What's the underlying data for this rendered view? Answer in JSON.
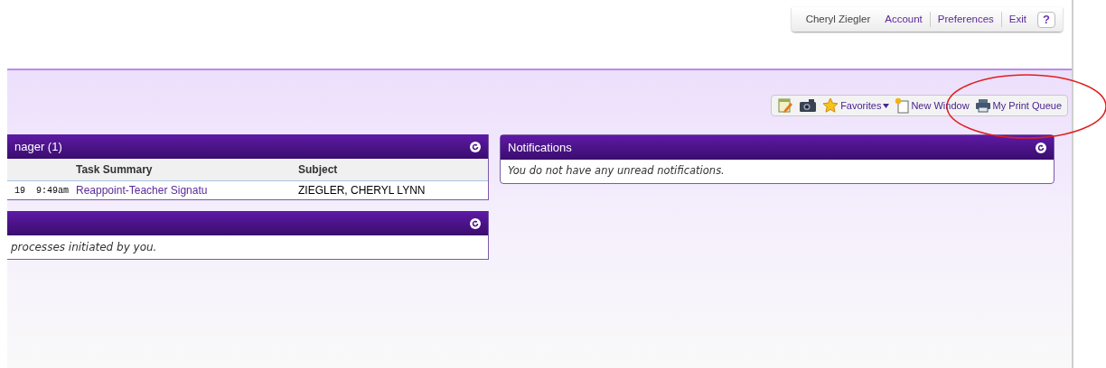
{
  "user_bar": {
    "user_name": "Cheryl Ziegler",
    "links": [
      "Account",
      "Preferences",
      "Exit"
    ],
    "help": "?"
  },
  "toolbar": {
    "items": [
      {
        "kind": "notes"
      },
      {
        "kind": "camera"
      },
      {
        "kind": "favorites",
        "label": "Favorites"
      },
      {
        "kind": "new_window",
        "label": "New Window"
      },
      {
        "kind": "print_queue",
        "label": "My Print Queue"
      }
    ]
  },
  "panels_left": [
    {
      "title": "nager (1)",
      "columns": [
        "Task Summary",
        "Subject"
      ],
      "rows": [
        {
          "time": "19  9:49am",
          "task": "Reappoint-Teacher Signatu",
          "subject": "ZIEGLER, CHERYL LYNN"
        }
      ]
    },
    {
      "message": "processes initiated by you."
    }
  ],
  "panels_right": [
    {
      "title": "Notifications",
      "message": "You do not have any unread notifications."
    }
  ],
  "annotation": {
    "kind": "ellipse",
    "color": "#e02020"
  }
}
